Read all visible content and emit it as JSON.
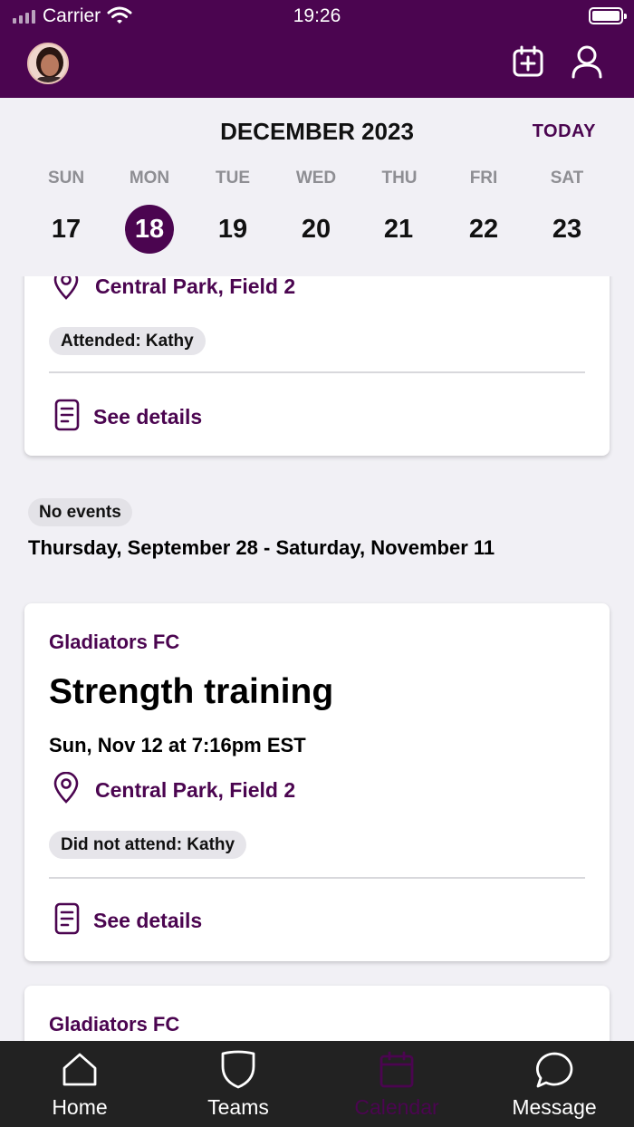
{
  "status_bar": {
    "carrier": "Carrier",
    "time": "19:26"
  },
  "header": {
    "avatar_icon": "user-avatar-photo",
    "add_event_icon": "calendar-plus-icon",
    "profile_icon": "person-icon"
  },
  "calendar": {
    "month": "DECEMBER 2023",
    "today_label": "TODAY",
    "days": [
      {
        "dow": "SUN",
        "date": "17"
      },
      {
        "dow": "MON",
        "date": "18"
      },
      {
        "dow": "TUE",
        "date": "19"
      },
      {
        "dow": "WED",
        "date": "20"
      },
      {
        "dow": "THU",
        "date": "21"
      },
      {
        "dow": "FRI",
        "date": "22"
      },
      {
        "dow": "SAT",
        "date": "23"
      }
    ],
    "selected_date": "18"
  },
  "events": [
    {
      "location": "Central Park, Field 2",
      "attendance": "Attended: Kathy",
      "details_label": "See details"
    },
    {
      "team": "Gladiators FC",
      "title": "Strength training",
      "when": "Sun, Nov 12 at 7:16pm EST",
      "location": "Central Park, Field 2",
      "attendance": "Did not attend: Kathy",
      "details_label": "See details"
    },
    {
      "team": "Gladiators FC"
    }
  ],
  "gap": {
    "label": "No events",
    "range": "Thursday, September 28 - Saturday, November 11"
  },
  "tabs": [
    {
      "label": "Home",
      "icon": "home-icon"
    },
    {
      "label": "Teams",
      "icon": "shield-icon"
    },
    {
      "label": "Calendar",
      "icon": "calendar-icon"
    },
    {
      "label": "Message",
      "icon": "chat-bubble-icon"
    }
  ],
  "colors": {
    "brand": "#4b0550",
    "background": "#f1f0f5",
    "tabbar": "#222222"
  }
}
